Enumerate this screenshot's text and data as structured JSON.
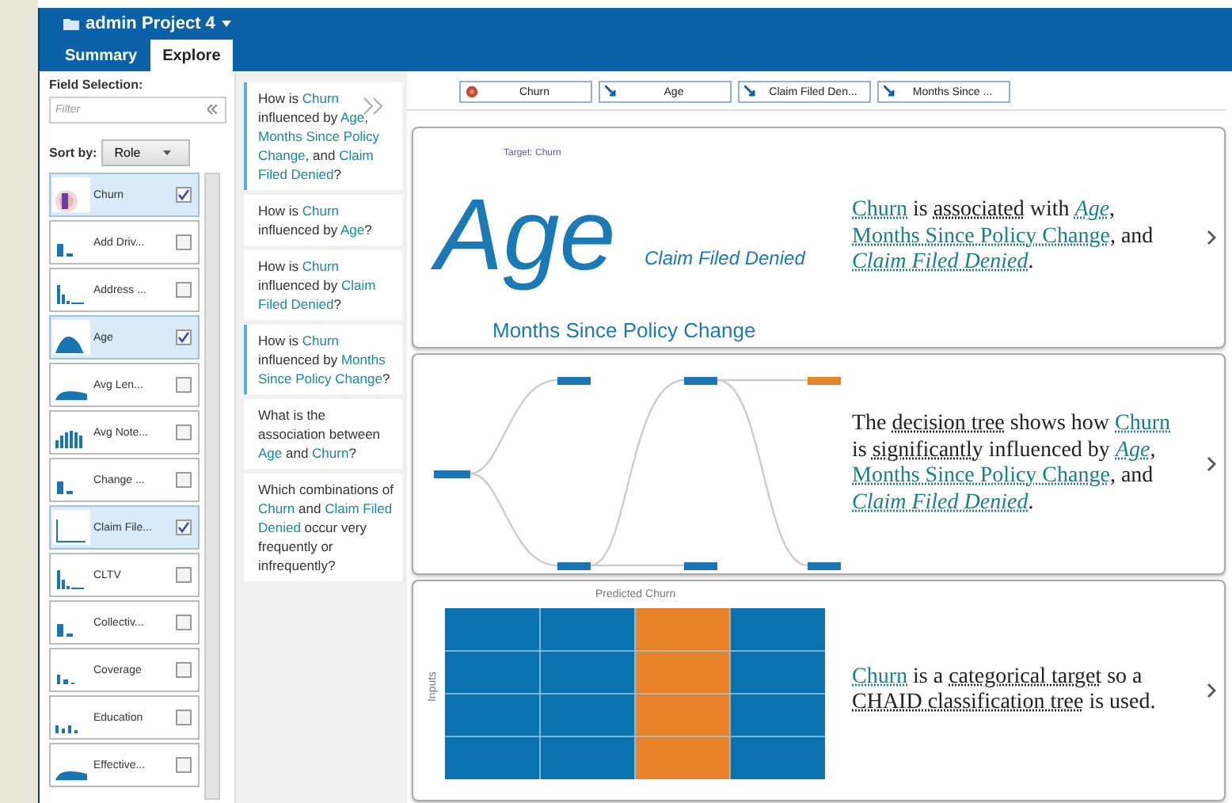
{
  "app": {
    "title": "admin Project 4"
  },
  "tabs": [
    {
      "label": "Summary",
      "selected": false
    },
    {
      "label": "Explore",
      "selected": true
    }
  ],
  "field_panel": {
    "heading": "Field Selection:",
    "filter_placeholder": "Filter",
    "sort_label": "Sort by:",
    "sort_value": "Role",
    "fields": [
      {
        "name": "Churn",
        "kind": "target",
        "checked": true
      },
      {
        "name": "Add Driv...",
        "kind": "two-bars",
        "checked": false
      },
      {
        "name": "Address ...",
        "kind": "decay",
        "checked": false
      },
      {
        "name": "Age",
        "kind": "hill",
        "checked": true
      },
      {
        "name": "Avg Len...",
        "kind": "slope",
        "checked": false
      },
      {
        "name": "Avg Note...",
        "kind": "many-bars",
        "checked": false
      },
      {
        "name": "Change ...",
        "kind": "two-bars",
        "checked": false
      },
      {
        "name": "Claim File...",
        "kind": "flat",
        "checked": true
      },
      {
        "name": "CLTV",
        "kind": "decay",
        "checked": false
      },
      {
        "name": "Collectiv...",
        "kind": "two-bars",
        "checked": false
      },
      {
        "name": "Coverage",
        "kind": "three-bars",
        "checked": false
      },
      {
        "name": "Education",
        "kind": "spaced-bars",
        "checked": false
      },
      {
        "name": "Effective...",
        "kind": "slope",
        "checked": false
      }
    ]
  },
  "questions": [
    {
      "selected": true,
      "parts": [
        {
          "text": "How is ",
          "kind": "plain"
        },
        {
          "text": "Churn",
          "kind": "field"
        },
        {
          "text": " influenced by ",
          "kind": "plain"
        },
        {
          "text": "Age",
          "kind": "field"
        },
        {
          "text": ", ",
          "kind": "plain"
        },
        {
          "text": "Months Since Policy Change",
          "kind": "field"
        },
        {
          "text": ", and ",
          "kind": "plain"
        },
        {
          "text": "Claim Filed Denied",
          "kind": "field"
        },
        {
          "text": "?",
          "kind": "plain"
        }
      ]
    },
    {
      "selected": false,
      "parts": [
        {
          "text": "How is ",
          "kind": "plain"
        },
        {
          "text": "Churn",
          "kind": "field"
        },
        {
          "text": " influenced by ",
          "kind": "plain"
        },
        {
          "text": "Age",
          "kind": "field"
        },
        {
          "text": "?",
          "kind": "plain"
        }
      ]
    },
    {
      "selected": false,
      "parts": [
        {
          "text": "How is ",
          "kind": "plain"
        },
        {
          "text": "Churn",
          "kind": "field"
        },
        {
          "text": " influenced by ",
          "kind": "plain"
        },
        {
          "text": "Claim Filed Denied",
          "kind": "field"
        },
        {
          "text": "?",
          "kind": "plain"
        }
      ]
    },
    {
      "selected": true,
      "parts": [
        {
          "text": "How is ",
          "kind": "plain"
        },
        {
          "text": "Churn",
          "kind": "field"
        },
        {
          "text": " influenced by ",
          "kind": "plain"
        },
        {
          "text": "Months Since Policy Change",
          "kind": "field"
        },
        {
          "text": "?",
          "kind": "plain"
        }
      ]
    },
    {
      "selected": false,
      "parts": [
        {
          "text": "What is the association between ",
          "kind": "plain"
        },
        {
          "text": "Age",
          "kind": "field"
        },
        {
          "text": " and ",
          "kind": "plain"
        },
        {
          "text": "Churn",
          "kind": "field"
        },
        {
          "text": "?",
          "kind": "plain"
        }
      ]
    },
    {
      "selected": false,
      "parts": [
        {
          "text": "Which combinations of ",
          "kind": "plain"
        },
        {
          "text": "Churn",
          "kind": "field"
        },
        {
          "text": " and ",
          "kind": "plain"
        },
        {
          "text": "Claim Filed Denied",
          "kind": "field"
        },
        {
          "text": " occur very frequently or infrequently?",
          "kind": "plain"
        }
      ]
    }
  ],
  "chips": [
    {
      "label": "Churn",
      "kind": "target"
    },
    {
      "label": "Age",
      "kind": "input"
    },
    {
      "label": "Claim Filed Den...",
      "kind": "input"
    },
    {
      "label": "Months Since ...",
      "kind": "input"
    }
  ],
  "cards": [
    {
      "kind": "word-cloud",
      "words": [
        {
          "text": "Target: Churn",
          "kind": "caption"
        },
        {
          "text": "Age",
          "kind": "large"
        },
        {
          "text": "Claim Filed Denied",
          "kind": "medium"
        },
        {
          "text": "Months Since Policy Change",
          "kind": "small"
        }
      ],
      "sentence": [
        {
          "text": "Churn",
          "kind": "link"
        },
        {
          "text": " is ",
          "kind": "plain"
        },
        {
          "text": "associated",
          "kind": "term"
        },
        {
          "text": " with ",
          "kind": "plain"
        },
        {
          "text": "Age",
          "kind": "field"
        },
        {
          "text": ", ",
          "kind": "plain"
        },
        {
          "text": "Months Since Policy Change",
          "kind": "link"
        },
        {
          "text": ", and ",
          "kind": "plain"
        },
        {
          "text": "Claim Filed Denied",
          "kind": "field"
        },
        {
          "text": ".",
          "kind": "plain"
        }
      ]
    },
    {
      "kind": "tree",
      "sentence": [
        {
          "text": "The ",
          "kind": "plain"
        },
        {
          "text": "decision tree",
          "kind": "term"
        },
        {
          "text": " shows how ",
          "kind": "plain"
        },
        {
          "text": "Churn",
          "kind": "link"
        },
        {
          "text": " is ",
          "kind": "plain"
        },
        {
          "text": "significantly",
          "kind": "term"
        },
        {
          "text": " influenced by ",
          "kind": "plain"
        },
        {
          "text": "Age",
          "kind": "field"
        },
        {
          "text": ", ",
          "kind": "plain"
        },
        {
          "text": "Months Since Policy Change",
          "kind": "link"
        },
        {
          "text": ", and ",
          "kind": "plain"
        },
        {
          "text": "Claim Filed Denied",
          "kind": "field"
        },
        {
          "text": ".",
          "kind": "plain"
        }
      ]
    },
    {
      "kind": "heatmap",
      "title": "Predicted Churn",
      "axis_label": "Inputs",
      "sentence": [
        {
          "text": "Churn",
          "kind": "link"
        },
        {
          "text": " is a ",
          "kind": "plain"
        },
        {
          "text": "categorical ",
          "kind": "term"
        },
        {
          "text": "target",
          "kind": "term"
        },
        {
          "text": " so a ",
          "kind": "plain"
        },
        {
          "text": "CHAID classification tree",
          "kind": "term"
        },
        {
          "text": " is used.",
          "kind": "plain"
        }
      ]
    }
  ]
}
